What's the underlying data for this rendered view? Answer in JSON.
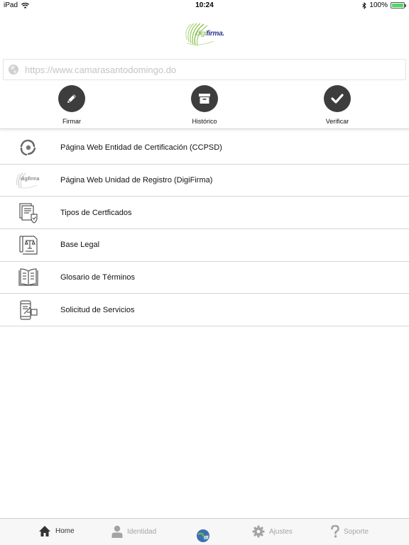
{
  "status_bar": {
    "device": "iPad",
    "time": "10:24",
    "battery": "100%",
    "battery_level": 1.0
  },
  "logo": {
    "text_part1": "digi",
    "text_part2": "firma."
  },
  "url_field": {
    "value": "",
    "placeholder": "https://www.camarasantodomingo.do"
  },
  "actions": [
    {
      "label": "Firmar",
      "icon": "pencil-icon"
    },
    {
      "label": "Histórico",
      "icon": "archive-box-icon"
    },
    {
      "label": "Verificar",
      "icon": "checkmark-icon"
    }
  ],
  "list": [
    {
      "label": "Página Web Entidad de Certificación (CCPSD)",
      "icon": "ccpsd-logo-icon"
    },
    {
      "label": "Página Web Unidad de Registro (DigiFirma)",
      "icon": "digifirma-logo-icon",
      "icon_text": "digifirma"
    },
    {
      "label": "Tipos de Certficados",
      "icon": "certificate-icon"
    },
    {
      "label": "Base Legal",
      "icon": "legal-document-icon"
    },
    {
      "label": "Glosario de Términos",
      "icon": "open-book-icon"
    },
    {
      "label": "Solicitud de Servicios",
      "icon": "service-request-icon"
    }
  ],
  "tab_bar": [
    {
      "label": "Home",
      "icon": "house-icon",
      "active": true
    },
    {
      "label": "Identidad",
      "icon": "person-icon",
      "active": false
    },
    {
      "label": "",
      "icon": "app-globe-logo-icon",
      "active": false
    },
    {
      "label": "Ajustes",
      "icon": "gear-icon",
      "active": false
    },
    {
      "label": "Soporte",
      "icon": "question-mark-icon",
      "active": false
    }
  ],
  "colors": {
    "action_circle": "#3d3d3d",
    "brand_green": "#7cb342",
    "brand_blue": "#2a3a8c",
    "battery": "#4cd964"
  }
}
